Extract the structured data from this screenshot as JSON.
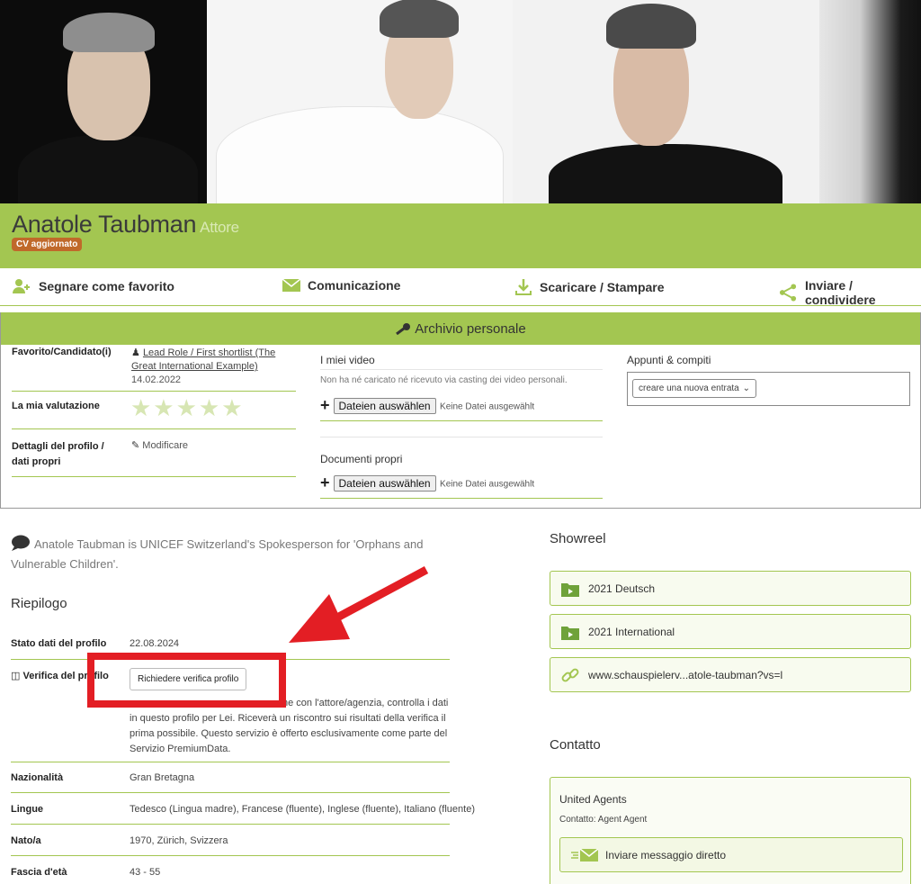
{
  "header": {
    "name": "Anatole Taubman",
    "role": "Attore",
    "badge": "CV aggiornato"
  },
  "actions": [
    {
      "label": "Segnare come favorito",
      "icon": "user-plus-icon"
    },
    {
      "label": "Comunicazione",
      "icon": "envelope-icon"
    },
    {
      "label": "Scaricare / Stampare",
      "icon": "download-icon"
    },
    {
      "label": "Inviare / condividere",
      "icon": "share-icon"
    }
  ],
  "archive": {
    "title": "Archivio personale",
    "favorite_label": "Favorito/Candidato(i)",
    "favorite_link": "Lead Role / First shortlist (The Great International Example)",
    "favorite_date": "14.02.2022",
    "rating_label": "La mia valutazione",
    "rating_stars": "★★★★★",
    "details_label": "Dettagli del profilo / dati propri",
    "details_edit": "Modificare",
    "videos_title": "I miei video",
    "videos_text": "Non ha né caricato né ricevuto via casting dei video personali.",
    "file_button": "Dateien auswählen",
    "file_none": "Keine Datei ausgewählt",
    "docs_title": "Documenti propri",
    "notes_title": "Appunti & compiti",
    "notes_select": "creare una nuova entrata"
  },
  "bio": "Anatole Taubman is UNICEF Switzerland's Spokesperson for 'Orphans and Vulnerable Children'.",
  "summary": {
    "title": "Riepilogo",
    "status_label": "Stato dati del profilo",
    "status_value": "22.08.2024",
    "verify_label": "Verifica del profilo",
    "verify_button": "Richiedere verifica profilo",
    "verify_text": "ne con l'attore/agenzia, controlla i dati in questo profilo per Lei. Riceverà un riscontro sui risultati della verifica il prima possibile. Questo servizio è offerto esclusivamente come parte del Servizio PremiumData.",
    "nationality_label": "Nazionalità",
    "nationality_value": "Gran Bretagna",
    "languages_label": "Lingue",
    "languages_value": "Tedesco (Lingua madre), Francese (fluente), Inglese (fluente), Italiano (fluente)",
    "born_label": "Nato/a",
    "born_value": "1970, Zürich, Svizzera",
    "age_label": "Fascia d'età",
    "age_value": "43 - 55"
  },
  "showreel": {
    "title": "Showreel",
    "items": [
      "2021 Deutsch",
      "2021 International",
      "www.schauspielerv...atole-taubman?vs=l"
    ]
  },
  "contact": {
    "title": "Contatto",
    "agency": "United Agents",
    "person": "Contatto: Agent Agent",
    "message_button": "Inviare messaggio diretto"
  },
  "colors": {
    "brand_green": "#a3c651",
    "badge_orange": "#c0692a",
    "annotation_red": "#e31e24"
  }
}
